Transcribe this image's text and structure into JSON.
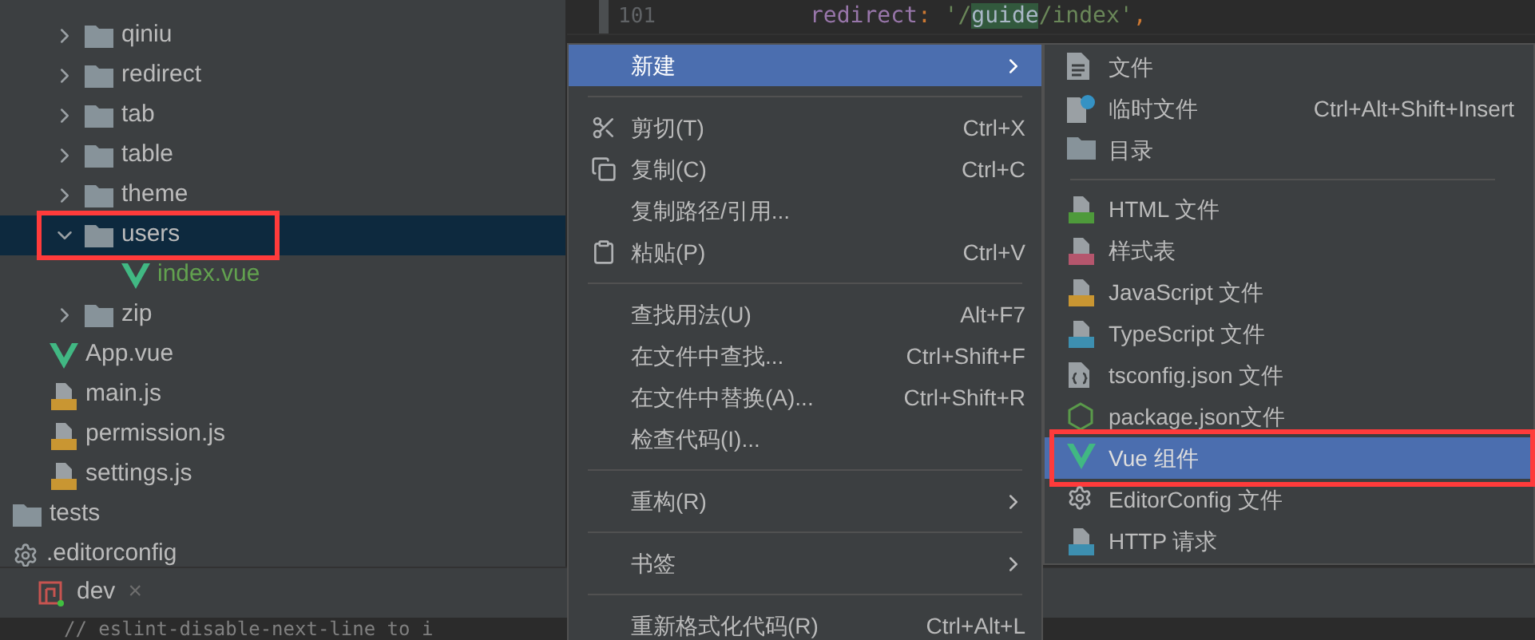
{
  "tree": [
    {
      "kind": "group",
      "children": [
        {
          "kind": "group",
          "children": [
            {
              "kind": "folder",
              "label": "qiniu",
              "expanded": false,
              "selected": false,
              "marked": false
            },
            {
              "kind": "folder",
              "label": "redirect",
              "expanded": false,
              "selected": false,
              "marked": false
            },
            {
              "kind": "folder",
              "label": "tab",
              "expanded": false,
              "selected": false,
              "marked": false
            },
            {
              "kind": "folder",
              "label": "table",
              "expanded": false,
              "selected": false,
              "marked": false
            },
            {
              "kind": "folder",
              "label": "theme",
              "expanded": false,
              "selected": false,
              "marked": false
            },
            {
              "kind": "folder",
              "label": "users",
              "expanded": true,
              "selected": true,
              "marked": true,
              "children": [
                {
                  "kind": "vue",
                  "label": "index.vue",
                  "new": true,
                  "selected": false,
                  "marked": false
                }
              ]
            },
            {
              "kind": "folder",
              "label": "zip",
              "expanded": false,
              "selected": false,
              "marked": false
            }
          ]
        },
        {
          "kind": "vue",
          "label": "App.vue",
          "new": false,
          "selected": false,
          "marked": false
        },
        {
          "kind": "js",
          "label": "main.js",
          "new": false,
          "selected": false,
          "marked": false
        },
        {
          "kind": "js",
          "label": "permission.js",
          "new": false,
          "selected": false,
          "marked": false
        },
        {
          "kind": "js",
          "label": "settings.js",
          "new": false,
          "selected": false,
          "marked": false
        }
      ]
    },
    {
      "kind": "plainfolder",
      "label": "tests",
      "selected": false,
      "marked": false
    },
    {
      "kind": "config",
      "label": ".editorconfig",
      "new": false,
      "selected": false,
      "marked": false
    }
  ],
  "editor": {
    "line_number": "101",
    "tokens": [
      {
        "kind": "key",
        "text": "redirect"
      },
      {
        "kind": "punct",
        "text": ": "
      },
      {
        "kind": "string",
        "text": "'/"
      },
      {
        "kind": "match",
        "text": "guide"
      },
      {
        "kind": "string",
        "text": "/index'"
      },
      {
        "kind": "punct",
        "text": ","
      }
    ]
  },
  "run_tab": {
    "label": "dev",
    "close": "×"
  },
  "console_line": "// eslint-disable-next-line to i",
  "context_menu": [
    {
      "kind": "item",
      "label": "新建",
      "submenu": true,
      "selected": true
    },
    {
      "kind": "separator"
    },
    {
      "kind": "scissors",
      "label": "剪切(T)",
      "shortcut": "Ctrl+X",
      "selected": false
    },
    {
      "kind": "copy",
      "label": "复制(C)",
      "shortcut": "Ctrl+C",
      "selected": false
    },
    {
      "kind": "item",
      "label": "复制路径/引用...",
      "selected": false
    },
    {
      "kind": "paste",
      "label": "粘贴(P)",
      "shortcut": "Ctrl+V",
      "selected": false
    },
    {
      "kind": "separator"
    },
    {
      "kind": "item",
      "label": "查找用法(U)",
      "shortcut": "Alt+F7",
      "selected": false
    },
    {
      "kind": "item",
      "label": "在文件中查找...",
      "shortcut": "Ctrl+Shift+F",
      "selected": false
    },
    {
      "kind": "item",
      "label": "在文件中替换(A)...",
      "shortcut": "Ctrl+Shift+R",
      "selected": false
    },
    {
      "kind": "item",
      "label": "检查代码(I)...",
      "selected": false
    },
    {
      "kind": "separator"
    },
    {
      "kind": "item",
      "label": "重构(R)",
      "submenu": true,
      "selected": false
    },
    {
      "kind": "separator"
    },
    {
      "kind": "item",
      "label": "书签",
      "submenu": true,
      "selected": false
    },
    {
      "kind": "separator"
    },
    {
      "kind": "item",
      "label": "重新格式化代码(R)",
      "shortcut": "Ctrl+Alt+L",
      "selected": false
    }
  ],
  "new_submenu": [
    {
      "kind": "file",
      "label": "文件",
      "selected": false,
      "marked": false
    },
    {
      "kind": "scratch",
      "label": "临时文件",
      "shortcut": "Ctrl+Alt+Shift+Insert",
      "selected": false,
      "marked": false
    },
    {
      "kind": "folder",
      "label": "目录",
      "selected": false,
      "marked": false
    },
    {
      "kind": "separator"
    },
    {
      "kind": "html",
      "label": "HTML 文件",
      "selected": false,
      "marked": false
    },
    {
      "kind": "css",
      "label": "样式表",
      "selected": false,
      "marked": false
    },
    {
      "kind": "js",
      "label": "JavaScript 文件",
      "selected": false,
      "marked": false
    },
    {
      "kind": "ts",
      "label": "TypeScript 文件",
      "selected": false,
      "marked": false
    },
    {
      "kind": "json",
      "label": "tsconfig.json 文件",
      "selected": false,
      "marked": false
    },
    {
      "kind": "node",
      "label": "package.json文件",
      "selected": false,
      "marked": false
    },
    {
      "kind": "vue",
      "label": "Vue 组件",
      "selected": true,
      "marked": true
    },
    {
      "kind": "gear",
      "label": "EditorConfig 文件",
      "selected": false,
      "marked": false
    },
    {
      "kind": "api",
      "label": "HTTP 请求",
      "selected": false,
      "marked": false
    }
  ]
}
